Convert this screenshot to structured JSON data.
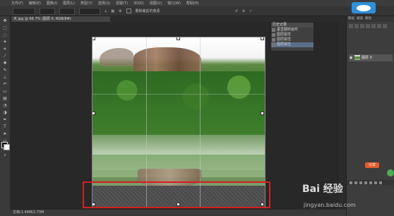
{
  "menu": [
    "文件(F)",
    "编辑(E)",
    "图像(I)",
    "图层(L)",
    "类型(Y)",
    "选择(S)",
    "滤镜(T)",
    "3D(D)",
    "视图(V)",
    "窗口(W)",
    "帮助(H)"
  ],
  "options": {
    "checkbox_label": "删除裁剪的像素"
  },
  "document_tab": "天.jpg @ 66.7% (图层 0, RGB/8#)",
  "history": {
    "title": "历史记录",
    "rows": [
      "垂直翻转画布",
      "图层属性",
      "图层属性",
      "图层属性"
    ]
  },
  "layers": {
    "tabs": [
      "图层",
      "通道",
      "路径"
    ],
    "layer_name": "图层 0"
  },
  "status": "文档:1.44M/2.73M",
  "watermark": {
    "brand": "Bai 经验",
    "url": "jingyan.baidu.com"
  },
  "badge": "分享"
}
